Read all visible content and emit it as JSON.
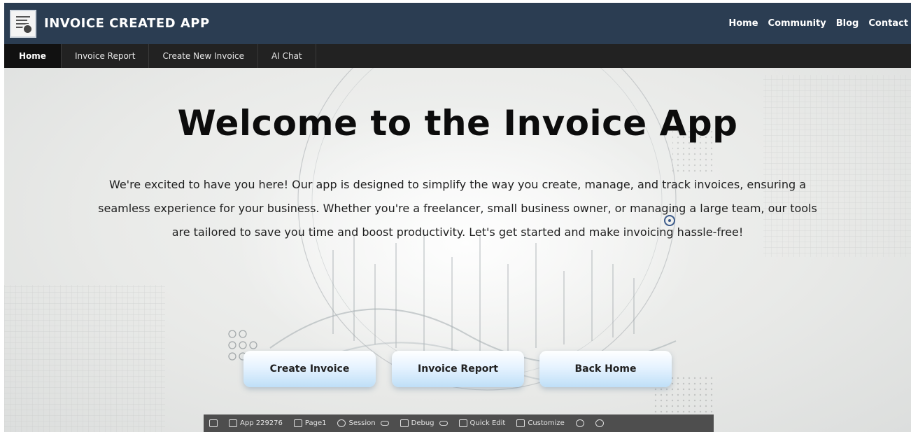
{
  "app": {
    "brand": "INVOICE CREATED APP",
    "logo_icon": "invoice-document-icon"
  },
  "top_nav": {
    "items": [
      "Home",
      "Community",
      "Blog",
      "Contact"
    ]
  },
  "sub_nav": {
    "active": "Home",
    "tabs": [
      "Home",
      "Invoice Report",
      "Create New Invoice",
      "AI Chat"
    ]
  },
  "hero": {
    "title": "Welcome to the Invoice App",
    "description": "We're excited to have you here! Our app is designed to simplify the way you create, manage, and track invoices, ensuring a seamless experience for your business. Whether you're a freelancer, small business owner, or managing a large team, our tools are tailored to save you time and boost productivity. Let's get started and make invoicing hassle-free!"
  },
  "buttons": {
    "create_invoice": "Create Invoice",
    "invoice_report": "Invoice Report",
    "back_home": "Back Home"
  },
  "toolbar": {
    "app": "App 229276",
    "page": "Page1",
    "session": "Session",
    "debug": "Debug",
    "quick_edit": "Quick Edit",
    "customize": "Customize",
    "icons": [
      "home-icon",
      "edit-icon",
      "page-icon",
      "session-icon",
      "debug-icon",
      "quick-edit-icon",
      "customize-icon",
      "info-icon",
      "settings-gear-icon"
    ]
  },
  "colors": {
    "header_bg": "#2b3d52",
    "subnav_bg": "#222222",
    "toolbar_bg": "#4e4e4e",
    "button_gradient_end": "#bfdff7"
  }
}
